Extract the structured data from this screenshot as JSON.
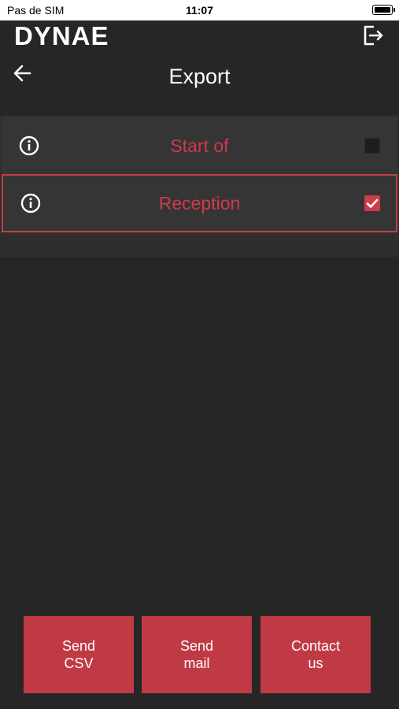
{
  "status_bar": {
    "carrier": "Pas de SIM",
    "time": "11:07",
    "battery_icon": "battery-full-icon"
  },
  "header": {
    "logo": "DYNAE",
    "logout_icon": "logout-icon",
    "back_icon": "arrow-left-icon",
    "title": "Export"
  },
  "list": {
    "items": [
      {
        "label": "Start of",
        "checked": false,
        "info_icon": "info-icon"
      },
      {
        "label": "Reception",
        "checked": true,
        "info_icon": "info-icon"
      }
    ]
  },
  "actions": {
    "send_csv": {
      "line1": "Send",
      "line2": "CSV"
    },
    "send_mail": {
      "line1": "Send",
      "line2": "mail"
    },
    "contact_us": {
      "line1": "Contact",
      "line2": "us"
    }
  },
  "colors": {
    "background": "#262626",
    "accent": "#c03a46",
    "text": "#ffffff"
  }
}
